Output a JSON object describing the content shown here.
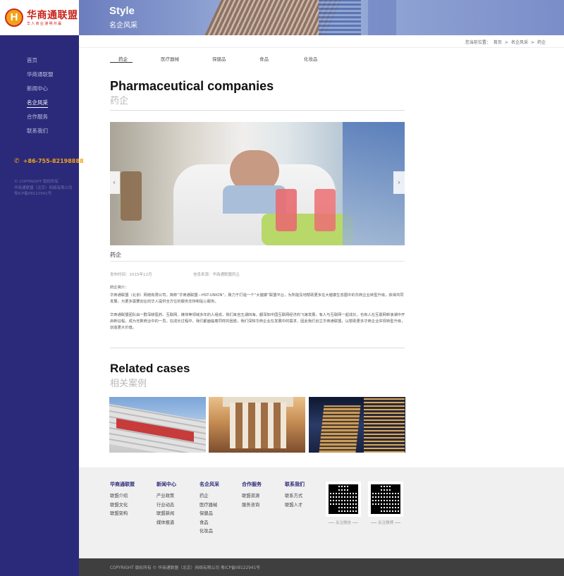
{
  "logo": {
    "mark": "H",
    "title": "华商通联盟",
    "slogan": "华人商业通明共赢"
  },
  "sidebar": {
    "items": [
      {
        "label": "首页"
      },
      {
        "label": "华商通联盟"
      },
      {
        "label": "新闻中心"
      },
      {
        "label": "名企风采"
      },
      {
        "label": "合作服务"
      },
      {
        "label": "联系我们"
      }
    ],
    "active_index": 3,
    "phone": "+86-755-82198888",
    "copyright_lines": [
      "© COPYRIGHT 版权所有",
      "华商通联盟（北京）网络有限公司",
      "粤ICP备08122941号"
    ]
  },
  "banner": {
    "title": "Style",
    "subtitle": "名企风采"
  },
  "breadcrumb": {
    "label": "您当前位置：",
    "items": [
      "首页",
      ">",
      "名企风采",
      ">",
      "药企"
    ]
  },
  "tabs": [
    {
      "label": "药企"
    },
    {
      "label": "医疗器械"
    },
    {
      "label": "保健品"
    },
    {
      "label": "食品"
    },
    {
      "label": "化妆品"
    }
  ],
  "article": {
    "title_en": "Pharmaceutical companies",
    "title_cn": "药企",
    "caption": "药企",
    "meta_date": "发布时间：2015年12月",
    "meta_source": "信息来源：华商通联盟药企",
    "intro_heading": "药企简介：",
    "paragraph1": "华商通联盟（北京）网络有限公司，简称“华商通联盟－HST-UNION”，致力于打造一个“大健康”联盟平台，为所能及地帮助更多在大健康生态圈中的华商企业转型升级，获得共同发展，为更多需要创业的华人提供全方位的服务支持和贴心服务。",
    "paragraph2": "华商通联盟团队由一群深耕医药、互联网、媒体等领域多年的人组成，我们来自五湖四海，都深知中国互联网经济的飞速发展，有人与互联网一起成长，也有人在互联网新浪潮中开启新征程，成为无数商业中的一员。在成长过程中，我们都面临着同样的困惑，我们深知华商企业在发展中的需求，因此我们创立华商通联盟，以帮助更多华商企业实现转型升级，创造更大价值。"
  },
  "related": {
    "title_en": "Related cases",
    "title_cn": "相关案例",
    "cases": [
      {
        "image": "hospital-building"
      },
      {
        "image": "colonnade-building"
      },
      {
        "image": "night-skyscraper"
      }
    ]
  },
  "footer": {
    "columns": [
      {
        "heading": "华商通联盟",
        "items": [
          "联盟介绍",
          "联盟文化",
          "联盟架构"
        ]
      },
      {
        "heading": "新闻中心",
        "items": [
          "产业政策",
          "行业动态",
          "联盟新闻",
          "媒体报道"
        ]
      },
      {
        "heading": "名企风采",
        "items": [
          "药企",
          "医疗器械",
          "保健品",
          "食品",
          "化妆品"
        ]
      },
      {
        "heading": "合作服务",
        "items": [
          "联盟资源",
          "服务咨询"
        ]
      },
      {
        "heading": "联系我们",
        "items": [
          "联系方式",
          "联盟人才"
        ]
      }
    ],
    "qr": [
      {
        "label": "关注微信"
      },
      {
        "label": "关注微博"
      }
    ],
    "copyright": "COPYRIGHT 版权所有 © 华商通联盟（北京）网络有限公司 粤ICP备08122941号"
  },
  "colors": {
    "sidebar": "#2b2a7a",
    "accent_orange": "#f2a21a",
    "logo_red": "#c8221c",
    "footer_bg": "#f0f0f0",
    "bottom_bar": "#3f3f3f"
  },
  "icons": {
    "phone": "phone-icon",
    "prev": "chevron-left-icon",
    "next": "chevron-right-icon"
  }
}
